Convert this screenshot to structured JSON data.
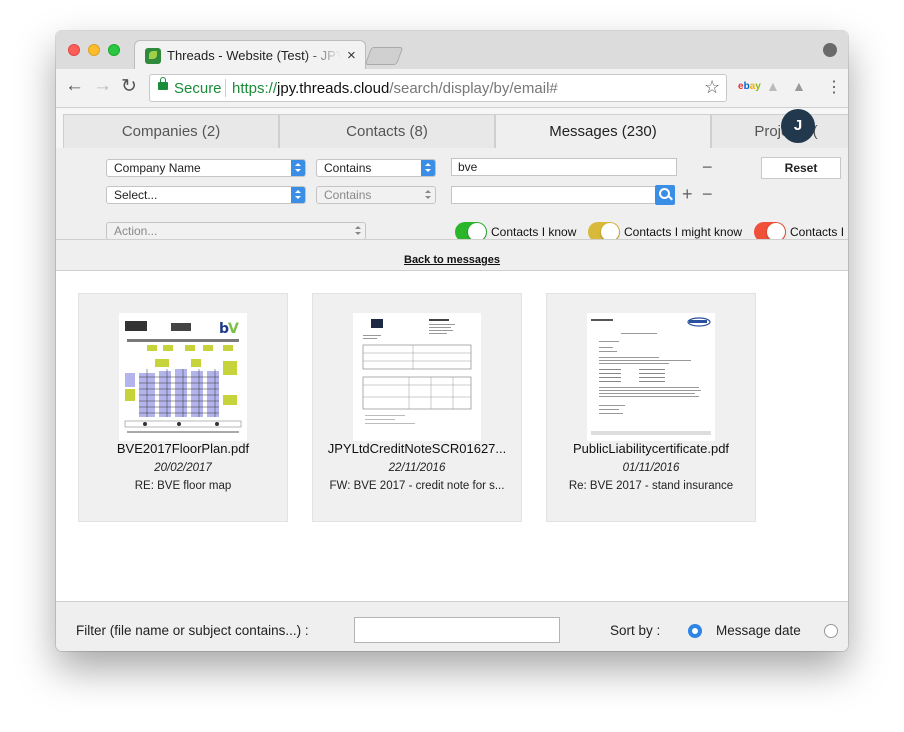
{
  "browser": {
    "tab_title": "Threads - Website (Test) - JPY",
    "tab_close": "×",
    "nav": {
      "back": "←",
      "forward": "→",
      "reload": "↻"
    },
    "secure_label": "Secure",
    "url_scheme": "https://",
    "url_host": "jpy.threads.cloud",
    "url_path": "/search/display/by/email#",
    "star": "☆",
    "menu": "⋮",
    "extensions": {
      "ebay": "ebay"
    },
    "colors": {
      "secure": "#1a8c3a",
      "ebay_e": "#e53238",
      "ebay_b": "#0064d2",
      "ebay_a": "#f5af02",
      "ebay_y": "#86b817"
    }
  },
  "app": {
    "tabs": [
      {
        "label": "Companies  (2)"
      },
      {
        "label": "Contacts  (8)"
      },
      {
        "label": "Messages (230)"
      },
      {
        "label": "Projects  ("
      }
    ],
    "avatar_initial": "J",
    "filters": {
      "row1": {
        "field": "Company Name",
        "operator": "Contains",
        "value": "bve",
        "remove": "−"
      },
      "row2": {
        "field": "Select...",
        "operator": "Contains",
        "value": "",
        "add": "+",
        "remove": "−"
      },
      "reset_label": "Reset",
      "action_placeholder": "Action...",
      "toggles": [
        {
          "label": "Contacts I know",
          "color": "#2bb52b"
        },
        {
          "label": "Contacts I might know",
          "color": "#d9b93a"
        },
        {
          "label": "Contacts I",
          "color": "#f0503a"
        }
      ]
    },
    "back_link": "Back to messages",
    "attachments": [
      {
        "file_name": "BVE2017FloorPlan.pdf",
        "date": "20/02/2017",
        "subject": "RE: BVE floor map"
      },
      {
        "file_name": "JPYLtdCreditNoteSCR01627...",
        "date": "22/11/2016",
        "subject": "FW: BVE 2017 - credit note for s..."
      },
      {
        "file_name": "PublicLiabilitycertificate.pdf",
        "date": "01/11/2016",
        "subject": "Re: BVE 2017 - stand insurance"
      }
    ],
    "footer": {
      "filter_label": "Filter (file name or subject contains...) :",
      "filter_value": "",
      "sort_label": "Sort by :",
      "sort_options": [
        {
          "label": "Message date",
          "selected": true
        },
        {
          "label": "",
          "selected": false
        }
      ]
    }
  }
}
